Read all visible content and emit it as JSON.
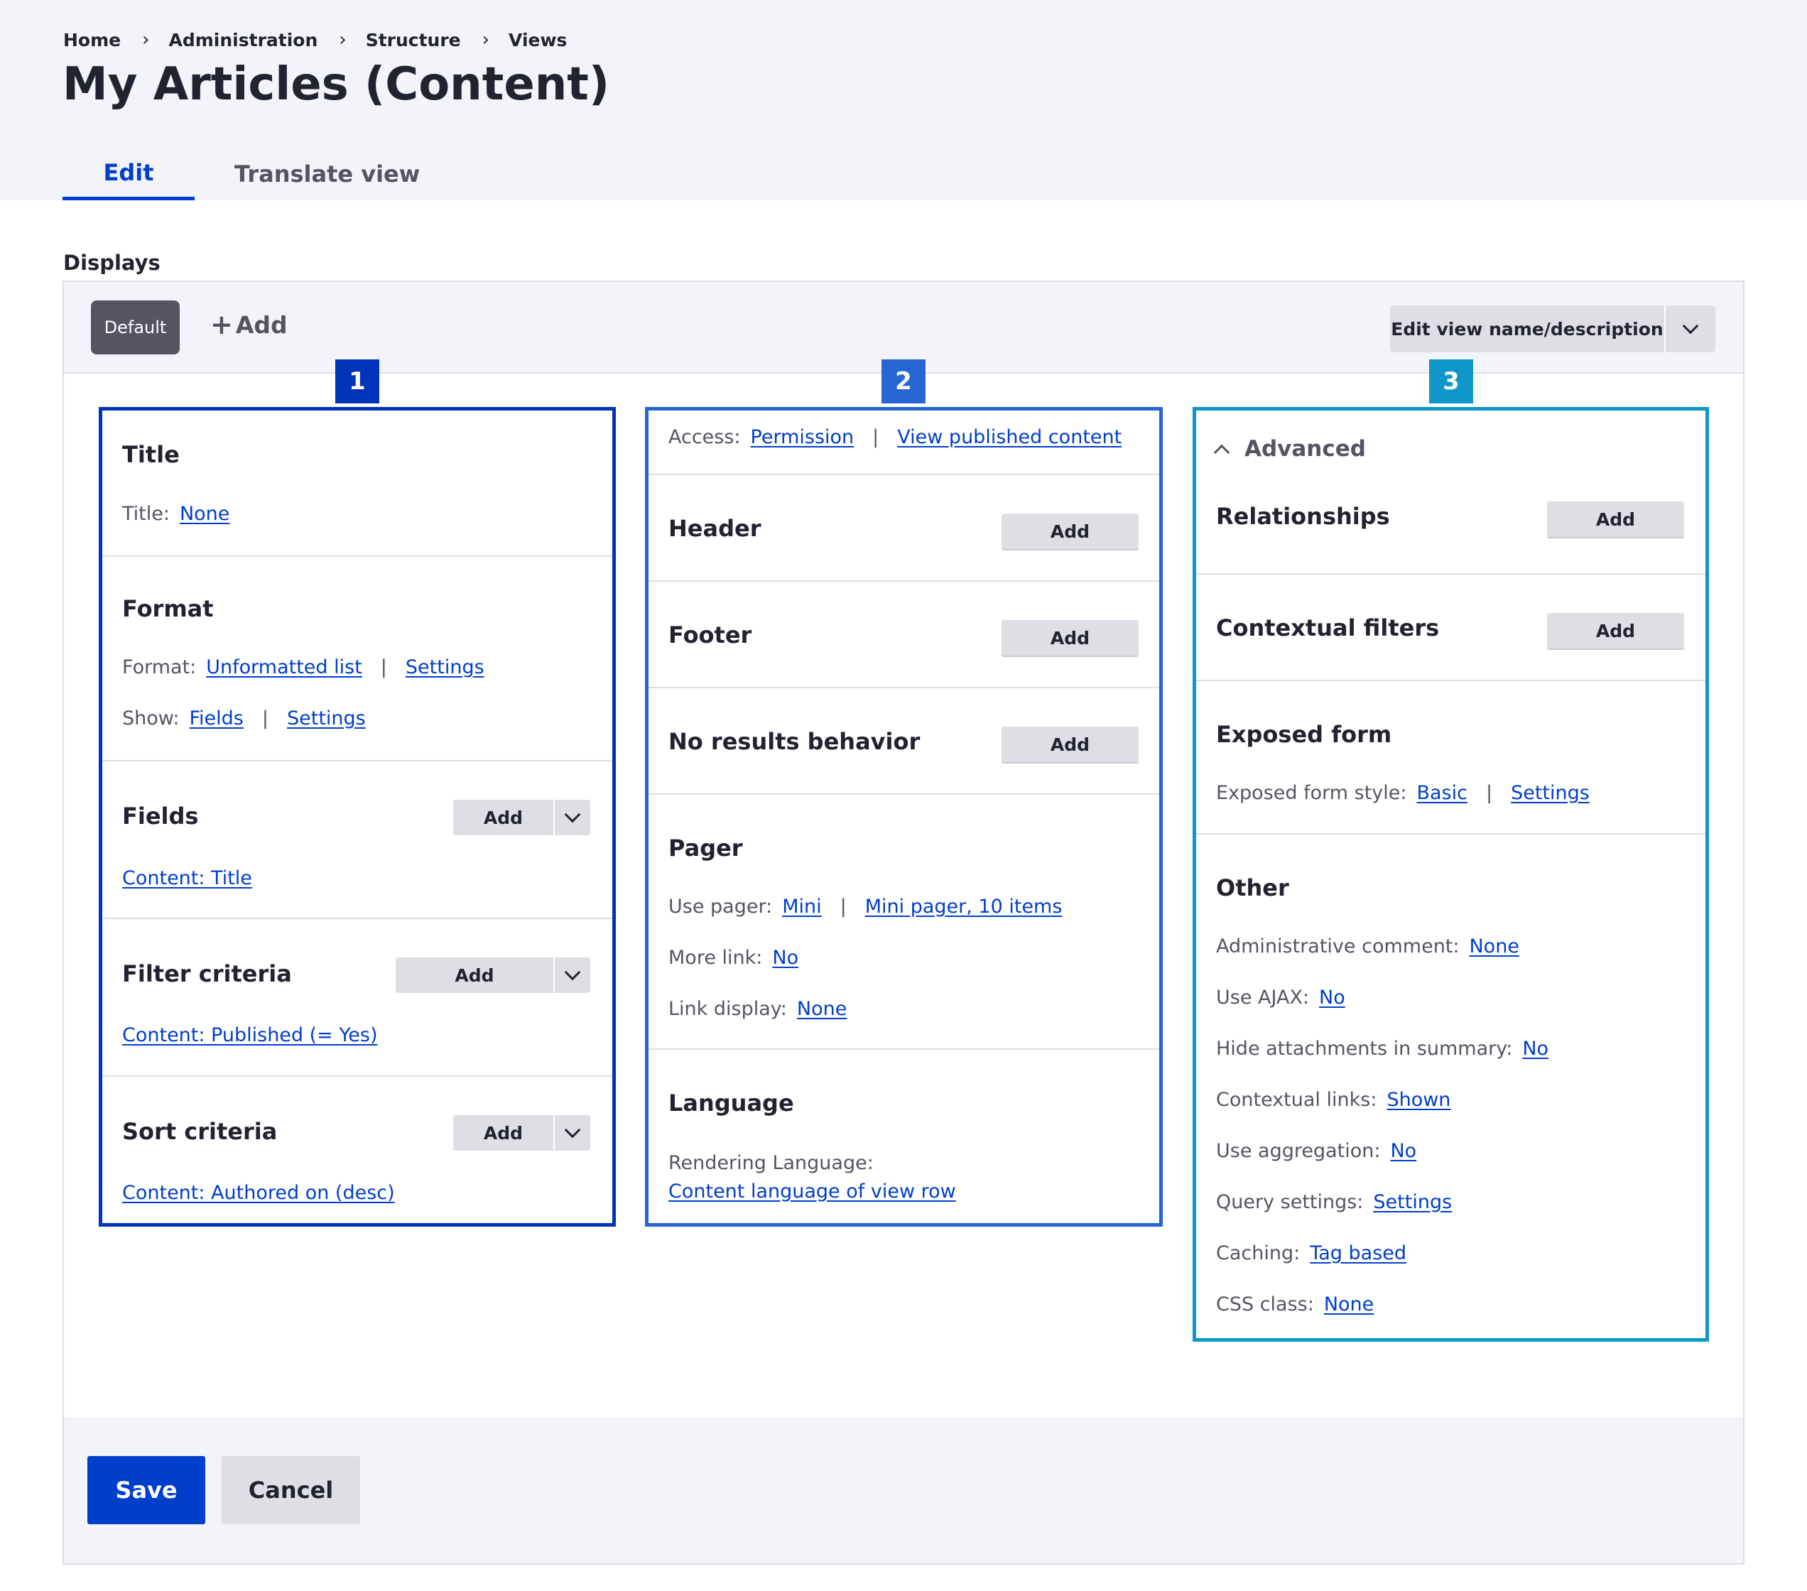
{
  "breadcrumb": [
    "Home",
    "Administration",
    "Structure",
    "Views"
  ],
  "page_title": "My Articles (Content)",
  "tabs": {
    "edit": "Edit",
    "translate": "Translate view"
  },
  "displays": {
    "label": "Displays",
    "default_button": "Default",
    "add_label": "Add",
    "edit_view_label": "Edit view name/description"
  },
  "badges": [
    "1",
    "2",
    "3"
  ],
  "column1": {
    "title": {
      "heading": "Title",
      "label": "Title:",
      "value": "None"
    },
    "format": {
      "heading": "Format",
      "format_label": "Format:",
      "format_value": "Unformatted list",
      "format_settings": "Settings",
      "show_label": "Show:",
      "show_value": "Fields",
      "show_settings": "Settings"
    },
    "fields": {
      "heading": "Fields",
      "add": "Add",
      "item": "Content: Title"
    },
    "filter": {
      "heading": "Filter criteria",
      "add": "Add",
      "item": "Content: Published (= Yes)"
    },
    "sort": {
      "heading": "Sort criteria",
      "add": "Add",
      "item": "Content: Authored on (desc)"
    }
  },
  "column2": {
    "access": {
      "label": "Access:",
      "value1": "Permission",
      "value2": "View published content"
    },
    "header": {
      "heading": "Header",
      "add": "Add"
    },
    "footer": {
      "heading": "Footer",
      "add": "Add"
    },
    "no_results": {
      "heading": "No results behavior",
      "add": "Add"
    },
    "pager": {
      "heading": "Pager",
      "use_pager_label": "Use pager:",
      "use_pager_value": "Mini",
      "use_pager_detail": "Mini pager, 10 items",
      "more_link_label": "More link:",
      "more_link_value": "No",
      "link_display_label": "Link display:",
      "link_display_value": "None"
    },
    "language": {
      "heading": "Language",
      "label": "Rendering Language:",
      "value": "Content language of view row"
    }
  },
  "column3": {
    "advanced_label": "Advanced",
    "relationships": {
      "heading": "Relationships",
      "add": "Add"
    },
    "contextual": {
      "heading": "Contextual filters",
      "add": "Add"
    },
    "exposed": {
      "heading": "Exposed form",
      "label": "Exposed form style:",
      "value": "Basic",
      "settings": "Settings"
    },
    "other": {
      "heading": "Other",
      "items": [
        {
          "label": "Administrative comment:",
          "value": "None"
        },
        {
          "label": "Use AJAX:",
          "value": "No"
        },
        {
          "label": "Hide attachments in summary:",
          "value": "No"
        },
        {
          "label": "Contextual links:",
          "value": "Shown"
        },
        {
          "label": "Use aggregation:",
          "value": "No"
        },
        {
          "label": "Query settings:",
          "value": "Settings"
        },
        {
          "label": "Caching:",
          "value": "Tag based"
        },
        {
          "label": "CSS class:",
          "value": "None"
        }
      ]
    }
  },
  "actions": {
    "save": "Save",
    "cancel": "Cancel"
  },
  "colors": {
    "accent": "#003ecc",
    "badge1": "#0034b8",
    "badge2": "#2666d4",
    "badge3": "#0e97c8",
    "header_bg": "#f3f4f9"
  }
}
